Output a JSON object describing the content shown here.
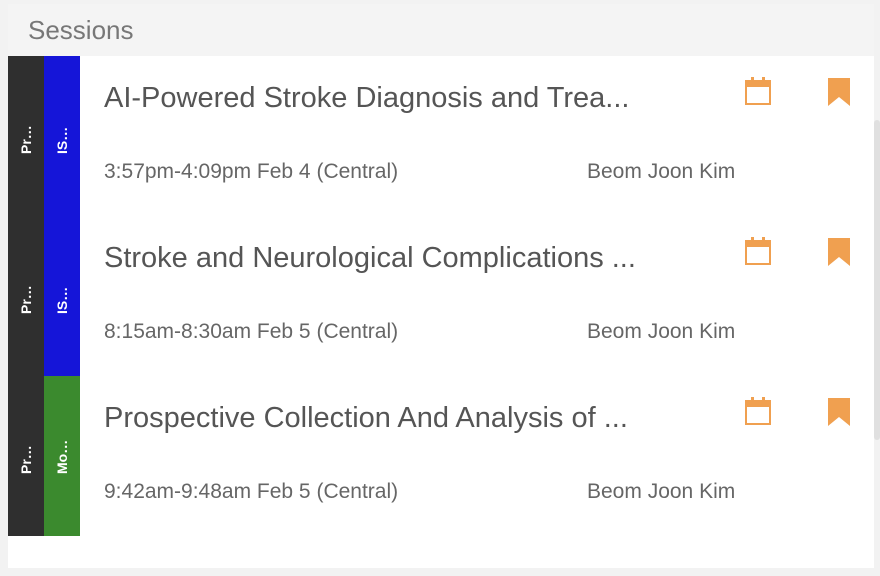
{
  "panel": {
    "title": "Sessions"
  },
  "sessions": [
    {
      "type_label": "Presentation",
      "track_label": "ISC Invited Sym...",
      "track_color": "#1515d8",
      "title": "AI-Powered Stroke Diagnosis and Trea...",
      "time": "3:57pm-4:09pm Feb 4 (Central)",
      "speaker": "Beom Joon Kim"
    },
    {
      "type_label": "Presentation",
      "track_label": "ISC Invited Sym...",
      "track_color": "#1515d8",
      "title": "Stroke and Neurological Complications ...",
      "time": "8:15am-8:30am Feb 5 (Central)",
      "speaker": "Beom Joon Kim"
    },
    {
      "type_label": "Presentation",
      "track_label": "Moderated Digit...",
      "track_color": "#3b8a2e",
      "title": "Prospective Collection And Analysis of ...",
      "time": "9:42am-9:48am Feb 5 (Central)",
      "speaker": "Beom Joon Kim"
    }
  ],
  "colors": {
    "icon_accent": "#f0a050",
    "type_stripe": "#2f2f2f"
  },
  "icons": {
    "calendar": "calendar-icon",
    "bookmark": "bookmark-icon"
  }
}
